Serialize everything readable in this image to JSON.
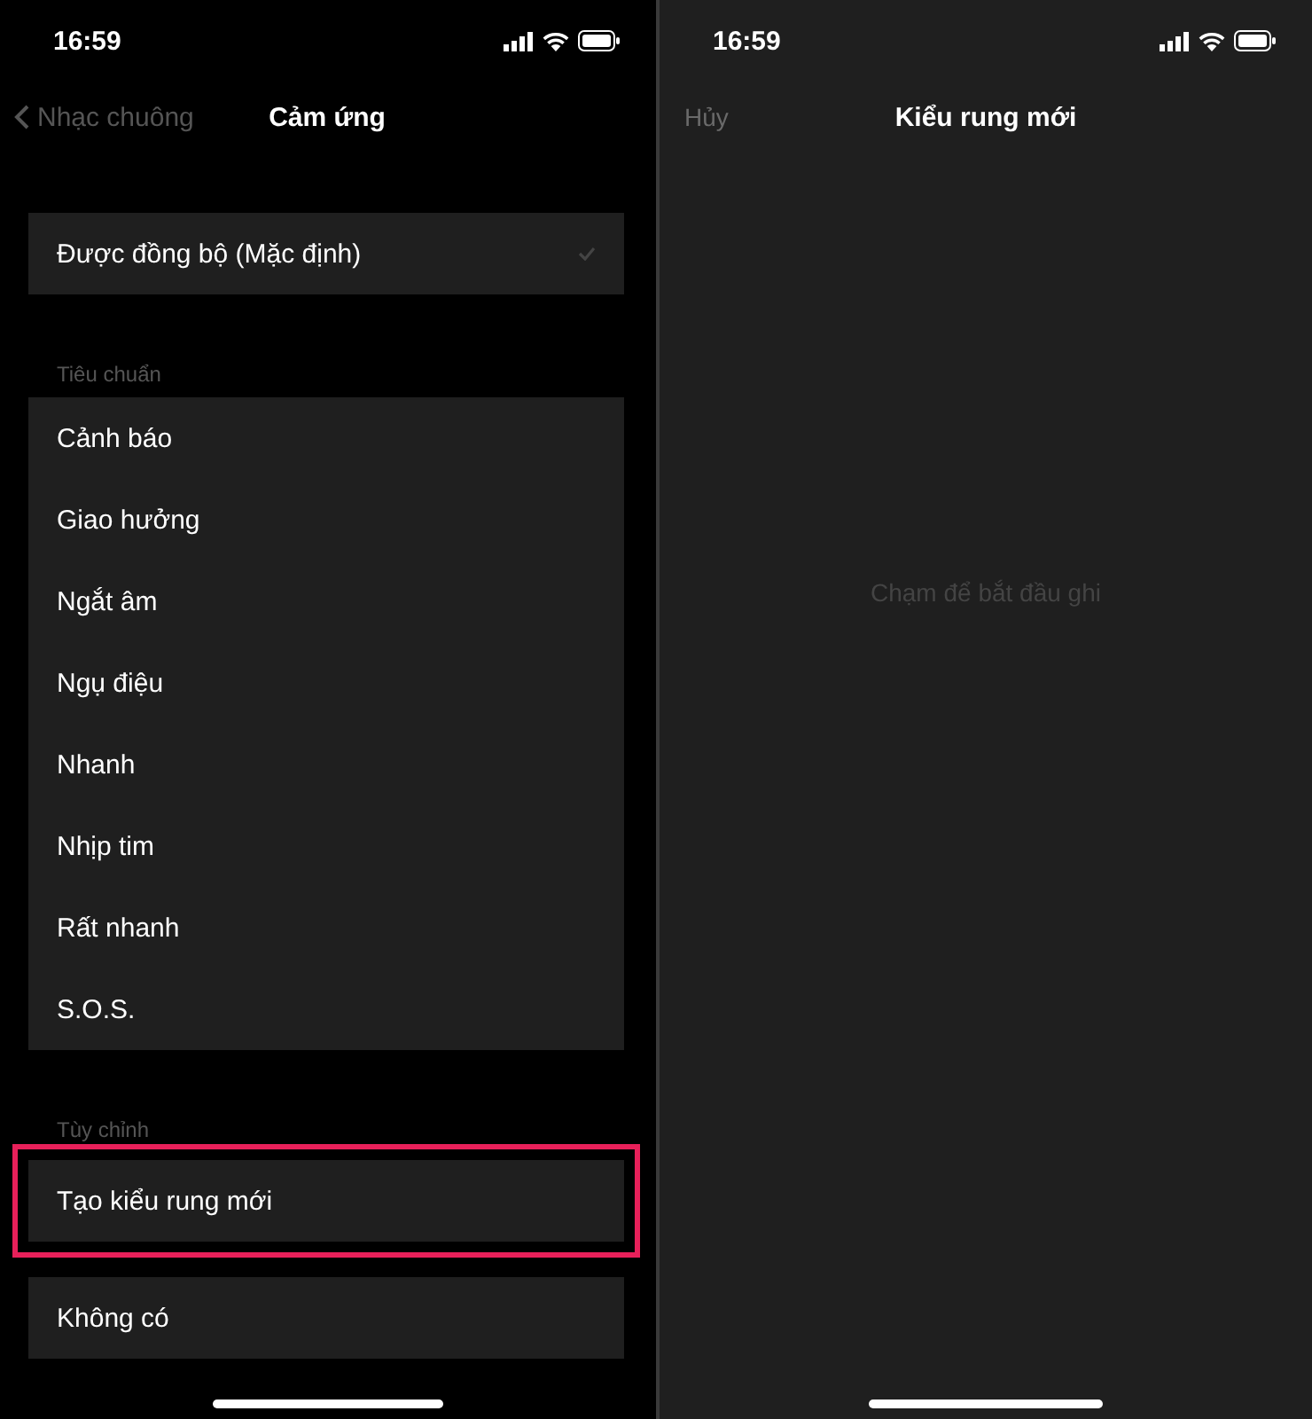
{
  "left_screen": {
    "status_bar": {
      "time": "16:59"
    },
    "nav": {
      "back": "Nhạc chuông",
      "title": "Cảm ứng"
    },
    "sync_option": {
      "label": "Được đồng bộ (Mặc định)",
      "selected": true
    },
    "sections": [
      {
        "header": "Tiêu chuẩn",
        "items": [
          {
            "label": "Cảnh báo",
            "highlighted": false
          },
          {
            "label": "Giao hưởng",
            "highlighted": false
          },
          {
            "label": "Ngắt âm",
            "highlighted": false
          },
          {
            "label": "Ngụ điệu",
            "highlighted": false
          },
          {
            "label": "Nhanh",
            "highlighted": false
          },
          {
            "label": "Nhịp tim",
            "highlighted": false
          },
          {
            "label": "Rất nhanh",
            "highlighted": false
          },
          {
            "label": "S.O.S.",
            "highlighted": false
          }
        ]
      },
      {
        "header": "Tùy chỉnh",
        "items": [
          {
            "label": "Tạo kiểu rung mới",
            "highlighted": true
          }
        ]
      }
    ],
    "none_option": {
      "label": "Không có"
    }
  },
  "right_screen": {
    "status_bar": {
      "time": "16:59"
    },
    "nav": {
      "cancel": "Hủy",
      "title": "Kiểu rung mới"
    },
    "hint": "Chạm để bắt đầu ghi"
  }
}
